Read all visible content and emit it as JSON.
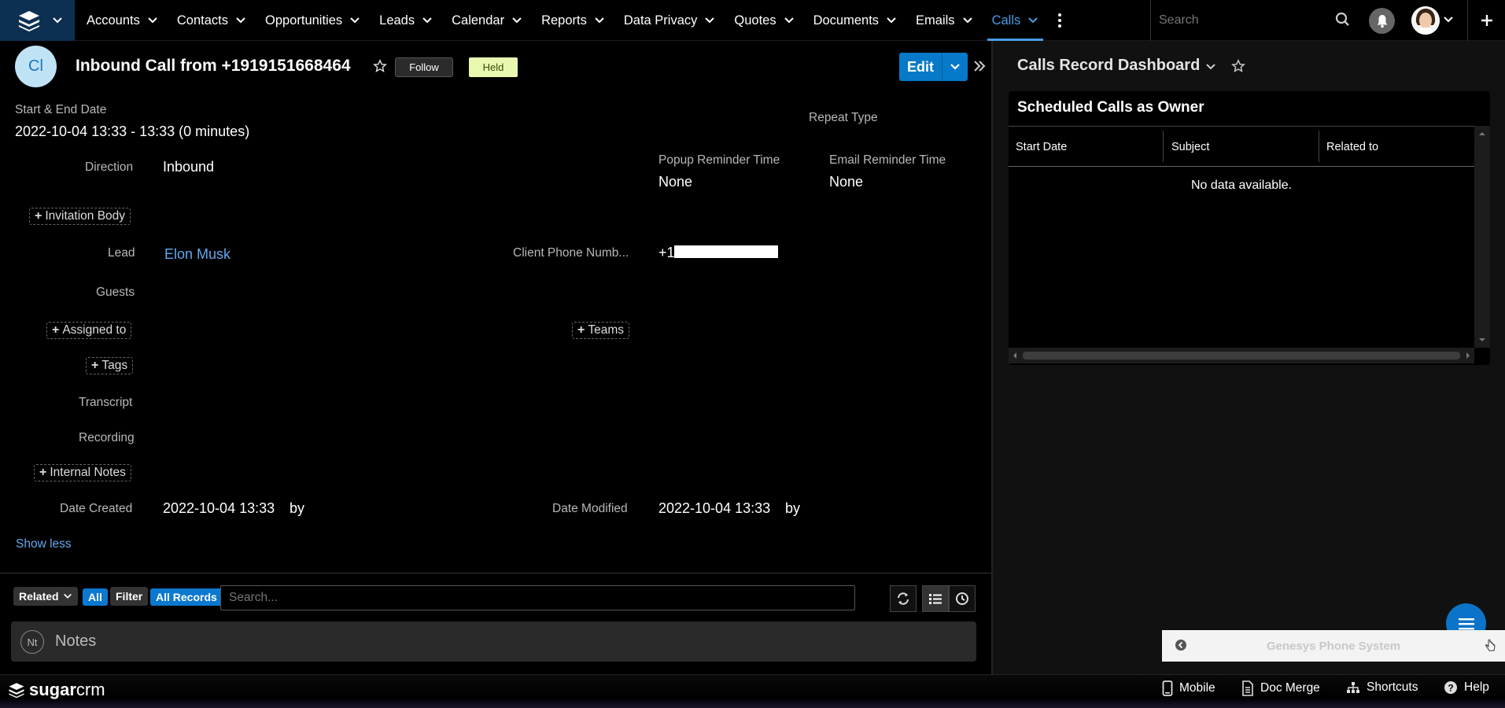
{
  "nav": {
    "items": [
      {
        "label": "Accounts"
      },
      {
        "label": "Contacts"
      },
      {
        "label": "Opportunities"
      },
      {
        "label": "Leads"
      },
      {
        "label": "Calendar"
      },
      {
        "label": "Reports"
      },
      {
        "label": "Data Privacy"
      },
      {
        "label": "Quotes"
      },
      {
        "label": "Documents"
      },
      {
        "label": "Emails"
      },
      {
        "label": "Calls"
      }
    ],
    "active": "Calls",
    "search_placeholder": "Search"
  },
  "record": {
    "avatar_initials": "Cl",
    "title": "Inbound Call from +1919151668464",
    "follow_label": "Follow",
    "status_badge": "Held",
    "edit_label": "Edit",
    "start_end_label": "Start & End Date",
    "start_end_value": "2022-10-04 13:33 - 13:33 (0 minutes)",
    "repeat_type_label": "Repeat Type",
    "direction_label": "Direction",
    "direction_value": "Inbound",
    "popup_reminder_label": "Popup Reminder Time",
    "popup_reminder_value": "None",
    "email_reminder_label": "Email Reminder Time",
    "email_reminder_value": "None",
    "invitation_body_btn": "Invitation Body",
    "lead_label": "Lead",
    "lead_value": "Elon Musk",
    "client_phone_label": "Client Phone Numb...",
    "client_phone_value": "+1",
    "guests_label": "Guests",
    "assigned_to_btn": "Assigned to",
    "teams_btn": "Teams",
    "tags_btn": "Tags",
    "transcript_label": "Transcript",
    "recording_label": "Recording",
    "internal_notes_btn": "Internal Notes",
    "date_created_label": "Date Created",
    "date_created_value": "2022-10-04 13:33",
    "date_created_by": "by",
    "date_modified_label": "Date Modified",
    "date_modified_value": "2022-10-04 13:33",
    "date_modified_by": "by",
    "show_less": "Show less"
  },
  "subpanel": {
    "related_label": "Related",
    "all_label": "All",
    "filter_label": "Filter",
    "all_records_label": "All Records",
    "search_placeholder": "Search...",
    "notes_initials": "Nt",
    "notes_label": "Notes"
  },
  "dashboard": {
    "title": "Calls Record Dashboard",
    "dashlet_title": "Scheduled Calls as Owner",
    "columns": [
      "Start Date",
      "Subject",
      "Related to"
    ],
    "empty_text": "No data available."
  },
  "genesys": {
    "label": "Genesys Phone System"
  },
  "footer": {
    "logo_sugar": "sugar",
    "logo_crm": "crm",
    "mobile": "Mobile",
    "doc_merge": "Doc Merge",
    "shortcuts": "Shortcuts",
    "help": "Help"
  },
  "colors": {
    "accent": "#0679c8",
    "link": "#61a8ee",
    "held_badge": "#e8f8b0",
    "active_tab": "#4a9de8"
  }
}
